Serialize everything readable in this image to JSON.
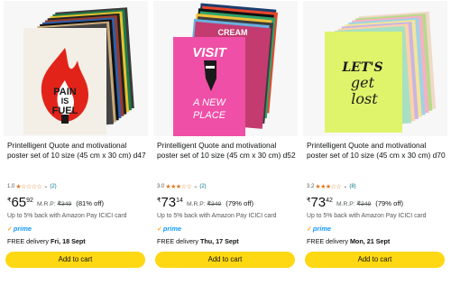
{
  "products": [
    {
      "title": "Printelligent Quote and motivational poster set of 10 size (45 cm x 30 cm) d47",
      "rating_value": "1.0",
      "stars": "★☆☆☆☆",
      "review_count": "(2)",
      "price_symbol": "₹",
      "price_whole": "65",
      "price_fraction": "92",
      "mrp_label": "M.R.P:",
      "mrp_value": "₹349",
      "discount": "(81% off)",
      "cashback": "Up to 5% back with Amazon Pay ICICI card",
      "prime_label": "prime",
      "delivery_label": "FREE delivery",
      "delivery_date": "Fri, 18 Sept",
      "add_to_cart": "Add to cart",
      "poster_text_line1": "PAIN",
      "poster_text_line2": "IS",
      "poster_text_line3": "FUEL"
    },
    {
      "title": "Printelligent Quote and motivational poster set of 10 size (45 cm x 30 cm) d52",
      "rating_value": "3.0",
      "stars": "★★★☆☆",
      "review_count": "(2)",
      "price_symbol": "₹",
      "price_whole": "73",
      "price_fraction": "14",
      "mrp_label": "M.R.P:",
      "mrp_value": "₹349",
      "discount": "(79% off)",
      "cashback": "Up to 5% back with Amazon Pay ICICI card",
      "prime_label": "prime",
      "delivery_label": "FREE delivery",
      "delivery_date": "Thu, 17 Sept",
      "add_to_cart": "Add to cart",
      "poster_text_line1": "VISIT",
      "poster_text_line2": "A NEW",
      "poster_text_line3": "PLACE",
      "poster_peek_text": "CREAM"
    },
    {
      "title": "Printelligent Quote and motivational poster set of 10 size (45 cm x 30 cm) d70",
      "rating_value": "3.2",
      "stars": "★★★☆☆",
      "review_count": "(8)",
      "price_symbol": "₹",
      "price_whole": "73",
      "price_fraction": "42",
      "mrp_label": "M.R.P:",
      "mrp_value": "₹349",
      "discount": "(79% off)",
      "cashback": "Up to 5% back with Amazon Pay ICICI card",
      "prime_label": "prime",
      "delivery_label": "FREE delivery",
      "delivery_date": "Mon, 21 Sept",
      "add_to_cart": "Add to cart",
      "poster_text_line1": "LET'S",
      "poster_text_line2": "get",
      "poster_text_line3": "lost"
    }
  ],
  "colors": {
    "star": "#de7921",
    "link": "#007185",
    "prime": "#1399ff",
    "button": "#ffd814",
    "poster_red": "#e2231a",
    "poster_pink": "#ef4fa6",
    "poster_lime": "#d8f24a"
  }
}
